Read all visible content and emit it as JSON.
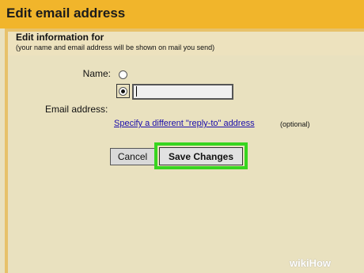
{
  "window": {
    "title": "Edit email address"
  },
  "section": {
    "heading": "Edit information for",
    "subheading": "(your name and email address will be shown on mail you send)"
  },
  "form": {
    "name_label": "Name:",
    "name_input_value": "",
    "email_label": "Email address:",
    "replyto_link": "Specify a different \"reply-to\" address",
    "optional_text": "(optional)"
  },
  "buttons": {
    "cancel": "Cancel",
    "save": "Save Changes"
  },
  "watermark": "wikiHow",
  "colors": {
    "title_bar": "#f1b52b",
    "panel_bg": "#e9e1bf",
    "highlight": "#37d51f",
    "link": "#1a0dab"
  }
}
